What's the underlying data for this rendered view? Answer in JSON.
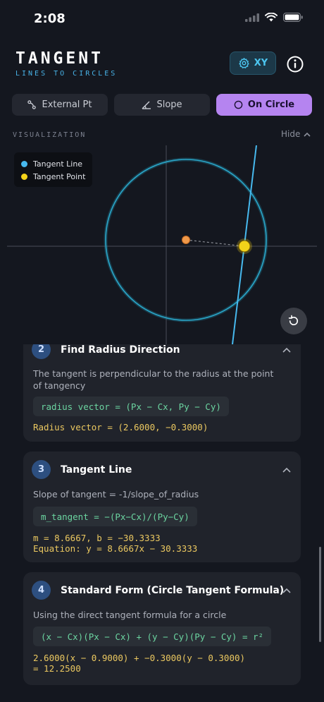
{
  "status": {
    "time": "2:08"
  },
  "header": {
    "title": "TANGENT",
    "subtitle": "LINES TO CIRCLES",
    "xy_label": "XY"
  },
  "tabs": [
    {
      "label": "External Pt",
      "icon": "external-point-icon",
      "active": false
    },
    {
      "label": "Slope",
      "icon": "slope-angle-icon",
      "active": false
    },
    {
      "label": "On Circle",
      "icon": "circle-icon",
      "active": true
    }
  ],
  "visualization": {
    "label": "VISUALIZATION",
    "hide_label": "Hide",
    "legend": [
      {
        "label": "Tangent Line",
        "color": "#47b9ee"
      },
      {
        "label": "Tangent Point",
        "color": "#f3d21a"
      }
    ],
    "colors": {
      "circle": "#2aa6c8",
      "tangent": "#47b9ee",
      "point": "#f3d21a",
      "center": "#f0994a"
    }
  },
  "steps": [
    {
      "number": "2",
      "title": "Find Radius Direction",
      "description": "The tangent is perpendicular to the radius at the point of tangency",
      "formula": "radius vector = (Px − Cx, Py − Cy)",
      "result": "Radius vector = (2.6000, −0.3000)"
    },
    {
      "number": "3",
      "title": "Tangent Line",
      "description": "Slope of tangent = -1/slope_of_radius",
      "formula": "m_tangent = −(Px−Cx)/(Py−Cy)",
      "result": "m = 8.6667, b = −30.3333\nEquation: y = 8.6667x − 30.3333"
    },
    {
      "number": "4",
      "title": "Standard Form (Circle Tangent Formula)",
      "description": "Using the direct tangent formula for a circle",
      "formula": "(x − Cx)(Px − Cx) + (y − Cy)(Py − Cy) = r²",
      "result": "2.6000(x − 0.9000) + −0.3000(y − 0.3000)\n= 12.2500"
    }
  ]
}
